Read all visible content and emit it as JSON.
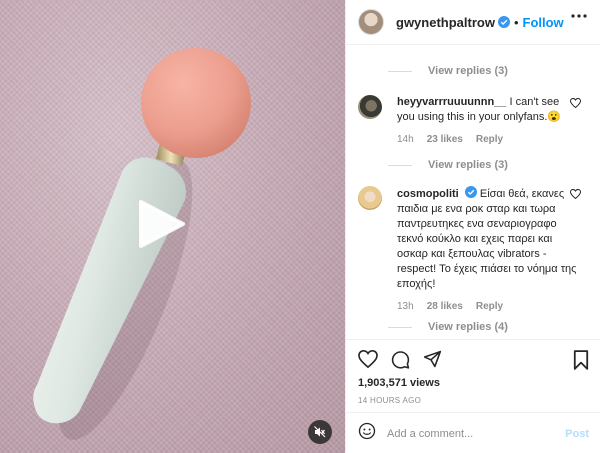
{
  "header": {
    "username": "gwynethpaltrow",
    "separator": "•",
    "follow_label": "Follow"
  },
  "comments": {
    "view_replies_top": "View replies (3)",
    "items": [
      {
        "username": "heyyvarrruuuunnn__",
        "text": "I can't see you using this in your onlyfans.😮",
        "time": "14h",
        "likes": "23 likes",
        "reply": "Reply",
        "view_replies": "View replies (3)"
      },
      {
        "username": "cosmopoliti",
        "text": "Είσαι θεά, εκανες παιδια με ενα ροκ σταρ και τωρα παντρευτηκες ενα σεναριογραφο τεκνό κούκλο και εχεις παρει και οσκαρ και ξεπουλας vibrators - respect!  Το έχεις πιάσει το νόημα της εποχής!",
        "time": "13h",
        "likes": "28 likes",
        "reply": "Reply",
        "view_replies": "View replies (4)"
      }
    ]
  },
  "actions": {
    "views": "1,903,571 views",
    "time_ago": "14 HOURS AGO"
  },
  "add_comment": {
    "placeholder": "Add a comment...",
    "post_label": "Post"
  },
  "colors": {
    "accent": "#0095f6",
    "post_disabled": "#b2dffc",
    "muted_text": "#8e8e8e",
    "wand_head": "#ec9e8e",
    "wand_handle": "#e2ebe6"
  },
  "icons": [
    "play-icon",
    "mute-icon",
    "more-icon",
    "verified-icon",
    "heart-icon",
    "comment-icon",
    "share-icon",
    "save-icon",
    "emoji-icon"
  ]
}
